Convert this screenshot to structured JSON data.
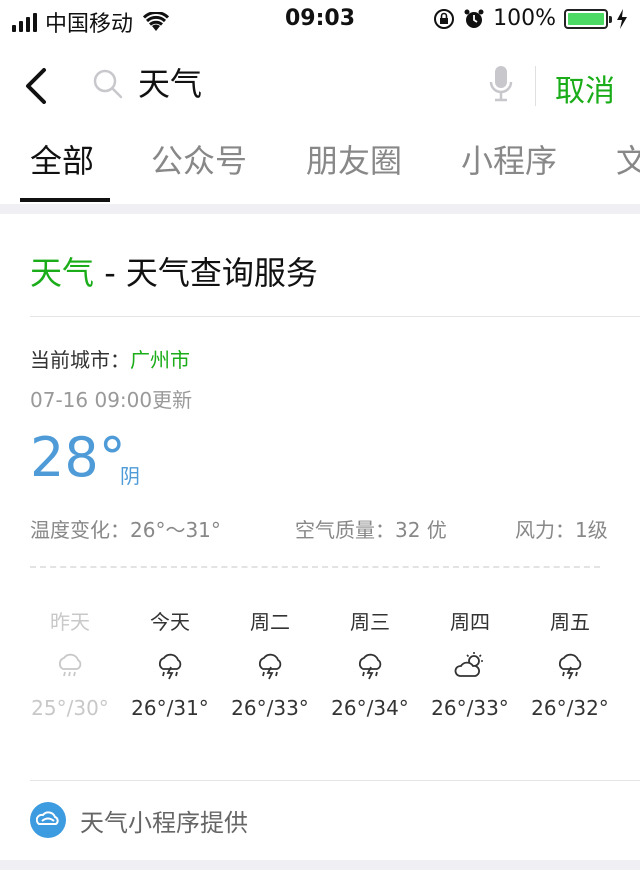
{
  "status": {
    "carrier": "中国移动",
    "time": "09:03",
    "battery": "100%"
  },
  "search": {
    "query": "天气",
    "cancel": "取消"
  },
  "tabs": [
    "全部",
    "公众号",
    "朋友圈",
    "小程序",
    "文"
  ],
  "card": {
    "title_highlight": "天气",
    "title_rest": " - 天气查询服务",
    "city_label": "当前城市：",
    "city": "广州市",
    "update": "07-16  09:00更新",
    "temp": "28°",
    "condition": "阴",
    "temp_change": "温度变化：26°～31°",
    "air": "空气质量：32 优",
    "wind": "风力：1级",
    "forecast": [
      {
        "day": "昨天",
        "range": "25°/30°",
        "icon": "thunder-rain-icon",
        "past": true
      },
      {
        "day": "今天",
        "range": "26°/31°",
        "icon": "thunder-rain-icon"
      },
      {
        "day": "周二",
        "range": "26°/33°",
        "icon": "thunder-rain-icon"
      },
      {
        "day": "周三",
        "range": "26°/34°",
        "icon": "thunder-rain-icon"
      },
      {
        "day": "周四",
        "range": "26°/33°",
        "icon": "partly-cloudy-icon"
      },
      {
        "day": "周五",
        "range": "26°/32°",
        "icon": "thunder-rain-icon"
      }
    ],
    "provider": "天气小程序提供"
  },
  "colors": {
    "accent": "#1aad19",
    "temp": "#4e9bd8"
  }
}
